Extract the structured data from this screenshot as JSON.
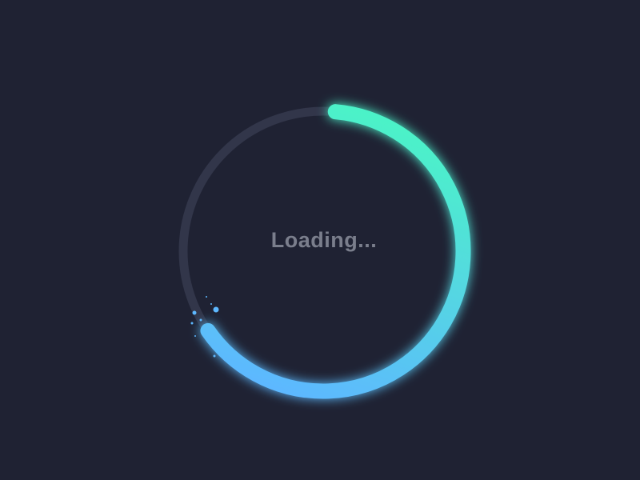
{
  "loader": {
    "label": "Loading...",
    "progress": 0.64,
    "colors": {
      "background": "#1f2233",
      "track": "#32364a",
      "gradient_start": "#4cf2c8",
      "gradient_end": "#5db8ff",
      "label": "#7a7e8c"
    }
  }
}
